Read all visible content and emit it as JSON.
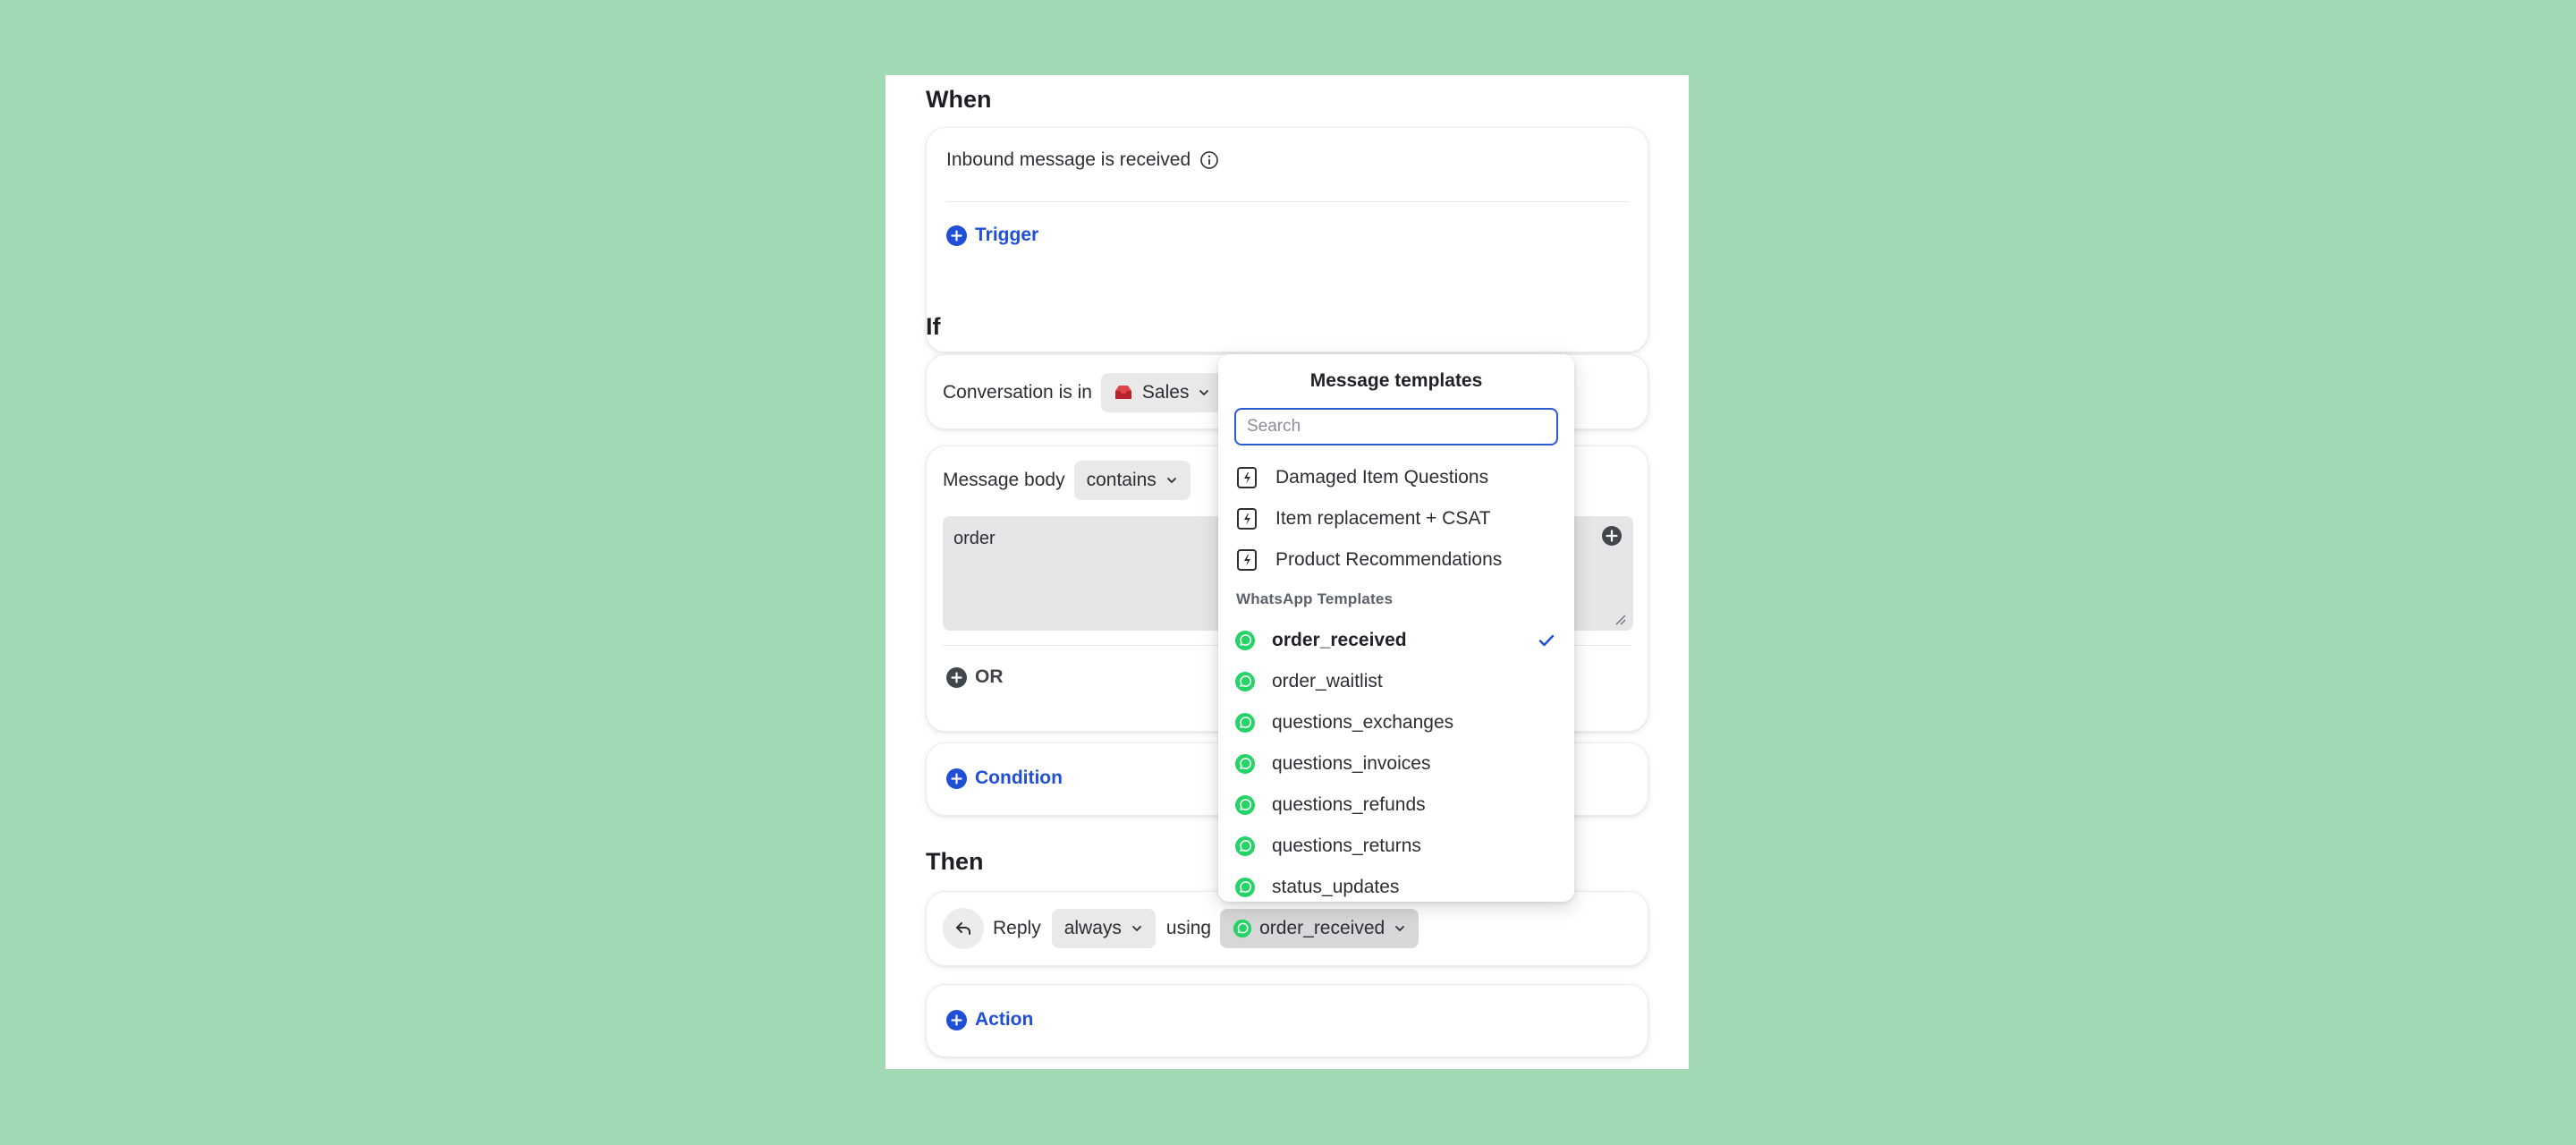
{
  "when": {
    "title": "When",
    "trigger_text": "Inbound message is received",
    "add_trigger": "Trigger"
  },
  "if": {
    "title": "If",
    "conversation_label": "Conversation is in",
    "inbox": "Sales",
    "message_body_label": "Message body",
    "operator": "contains",
    "body_value": "order",
    "or_label": "OR",
    "add_condition": "Condition"
  },
  "then": {
    "title": "Then",
    "action_label": "Reply",
    "frequency": "always",
    "using_label": "using",
    "template": "order_received",
    "add_action": "Action"
  },
  "dropdown": {
    "title": "Message templates",
    "search_placeholder": "Search",
    "templates": [
      {
        "label": "Damaged Item Questions"
      },
      {
        "label": "Item replacement + CSAT"
      },
      {
        "label": "Product Recommendations"
      }
    ],
    "whatsapp_group_label": "WhatsApp Templates",
    "whatsapp_templates": [
      {
        "label": "order_received",
        "selected": true
      },
      {
        "label": "order_waitlist",
        "selected": false
      },
      {
        "label": "questions_exchanges",
        "selected": false
      },
      {
        "label": "questions_invoices",
        "selected": false
      },
      {
        "label": "questions_refunds",
        "selected": false
      },
      {
        "label": "questions_returns",
        "selected": false
      },
      {
        "label": "status_updates",
        "selected": false
      }
    ]
  },
  "colors": {
    "background": "#a0d9b3",
    "accent_blue": "#1f4fd6",
    "whatsapp_green": "#25d366"
  }
}
